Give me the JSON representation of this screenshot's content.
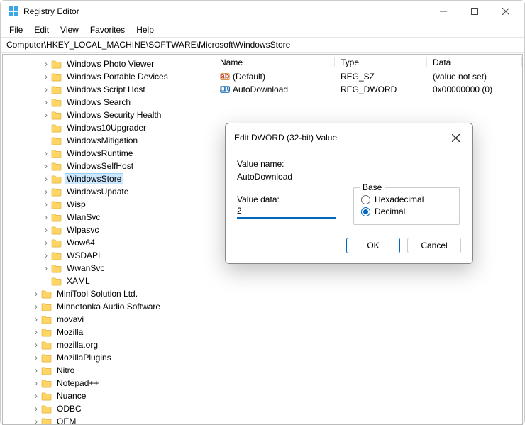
{
  "window": {
    "title": "Registry Editor"
  },
  "menu": {
    "items": [
      "File",
      "Edit",
      "View",
      "Favorites",
      "Help"
    ]
  },
  "address": "Computer\\HKEY_LOCAL_MACHINE\\SOFTWARE\\Microsoft\\WindowsStore",
  "tree": {
    "itemsA": [
      {
        "label": "Windows Photo Viewer",
        "indent": 54,
        "chev": ">"
      },
      {
        "label": "Windows Portable Devices",
        "indent": 54,
        "chev": ">"
      },
      {
        "label": "Windows Script Host",
        "indent": 54,
        "chev": ">"
      },
      {
        "label": "Windows Search",
        "indent": 54,
        "chev": ">"
      },
      {
        "label": "Windows Security Health",
        "indent": 54,
        "chev": ">"
      },
      {
        "label": "Windows10Upgrader",
        "indent": 54,
        "chev": ""
      },
      {
        "label": "WindowsMitigation",
        "indent": 54,
        "chev": ""
      },
      {
        "label": "WindowsRuntime",
        "indent": 54,
        "chev": ">"
      },
      {
        "label": "WindowsSelfHost",
        "indent": 54,
        "chev": ">"
      },
      {
        "label": "WindowsStore",
        "indent": 54,
        "chev": ">",
        "selected": true
      },
      {
        "label": "WindowsUpdate",
        "indent": 54,
        "chev": ">"
      },
      {
        "label": "Wisp",
        "indent": 54,
        "chev": ">"
      },
      {
        "label": "WlanSvc",
        "indent": 54,
        "chev": ">"
      },
      {
        "label": "Wlpasvc",
        "indent": 54,
        "chev": ">"
      },
      {
        "label": "Wow64",
        "indent": 54,
        "chev": ">"
      },
      {
        "label": "WSDAPI",
        "indent": 54,
        "chev": ">"
      },
      {
        "label": "WwanSvc",
        "indent": 54,
        "chev": ">"
      },
      {
        "label": "XAML",
        "indent": 54,
        "chev": ""
      }
    ],
    "itemsB": [
      {
        "label": "MiniTool Solution Ltd.",
        "indent": 40,
        "chev": ">"
      },
      {
        "label": "Minnetonka Audio Software",
        "indent": 40,
        "chev": ">"
      },
      {
        "label": "movavi",
        "indent": 40,
        "chev": ">"
      },
      {
        "label": "Mozilla",
        "indent": 40,
        "chev": ">"
      },
      {
        "label": "mozilla.org",
        "indent": 40,
        "chev": ">"
      },
      {
        "label": "MozillaPlugins",
        "indent": 40,
        "chev": ">"
      },
      {
        "label": "Nitro",
        "indent": 40,
        "chev": ">"
      },
      {
        "label": "Notepad++",
        "indent": 40,
        "chev": ">"
      },
      {
        "label": "Nuance",
        "indent": 40,
        "chev": ">"
      },
      {
        "label": "ODBC",
        "indent": 40,
        "chev": ">"
      },
      {
        "label": "OEM",
        "indent": 40,
        "chev": ">"
      }
    ]
  },
  "values": {
    "headers": {
      "name": "Name",
      "type": "Type",
      "data": "Data"
    },
    "rows": [
      {
        "icon": "sz",
        "name": "(Default)",
        "type": "REG_SZ",
        "data": "(value not set)"
      },
      {
        "icon": "dw",
        "name": "AutoDownload",
        "type": "REG_DWORD",
        "data": "0x00000000 (0)"
      }
    ]
  },
  "dialog": {
    "title": "Edit DWORD (32-bit) Value",
    "value_name_label": "Value name:",
    "value_name": "AutoDownload",
    "value_data_label": "Value data:",
    "value_data": "2",
    "base_label": "Base",
    "hex_label": "Hexadecimal",
    "dec_label": "Decimal",
    "ok": "OK",
    "cancel": "Cancel"
  }
}
